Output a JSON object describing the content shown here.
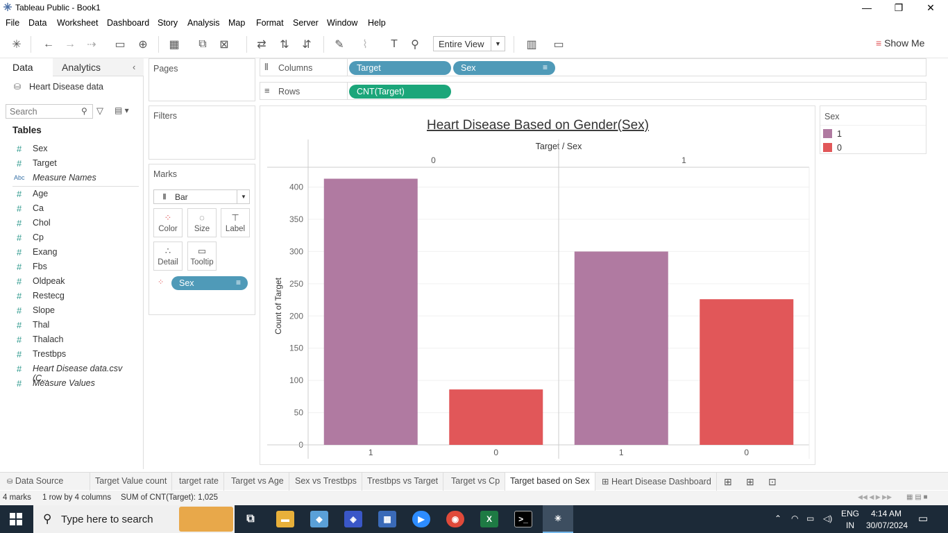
{
  "window": {
    "title": "Tableau Public - Book1",
    "minimize": "—",
    "maximize": "❐",
    "close": "✕"
  },
  "menu": [
    "File",
    "Data",
    "Worksheet",
    "Dashboard",
    "Story",
    "Analysis",
    "Map",
    "Format",
    "Server",
    "Window",
    "Help"
  ],
  "toolbar": {
    "fit_select": "Entire View",
    "show_me": "Show Me"
  },
  "data_pane": {
    "tab_data": "Data",
    "tab_analytics": "Analytics",
    "datasource": "Heart Disease data",
    "search_placeholder": "Search",
    "tables_heading": "Tables",
    "fields": [
      {
        "name": "Sex",
        "type": "number",
        "italic": false
      },
      {
        "name": "Target",
        "type": "number",
        "italic": false
      },
      {
        "name": "Measure Names",
        "type": "abc",
        "italic": true
      },
      {
        "name": "Age",
        "type": "number",
        "italic": false
      },
      {
        "name": "Ca",
        "type": "number",
        "italic": false
      },
      {
        "name": "Chol",
        "type": "number",
        "italic": false
      },
      {
        "name": "Cp",
        "type": "number",
        "italic": false
      },
      {
        "name": "Exang",
        "type": "number",
        "italic": false
      },
      {
        "name": "Fbs",
        "type": "number",
        "italic": false
      },
      {
        "name": "Oldpeak",
        "type": "number",
        "italic": false
      },
      {
        "name": "Restecg",
        "type": "number",
        "italic": false
      },
      {
        "name": "Slope",
        "type": "number",
        "italic": false
      },
      {
        "name": "Thal",
        "type": "number",
        "italic": false
      },
      {
        "name": "Thalach",
        "type": "number",
        "italic": false
      },
      {
        "name": "Trestbps",
        "type": "number",
        "italic": false
      },
      {
        "name": "Heart Disease data.csv (C...",
        "type": "number",
        "italic": true
      },
      {
        "name": "Measure Values",
        "type": "number",
        "italic": true
      }
    ]
  },
  "cards": {
    "pages": "Pages",
    "filters": "Filters",
    "marks": "Marks",
    "mark_type": "Bar",
    "mark_buttons": [
      "Color",
      "Size",
      "Label",
      "Detail",
      "Tooltip"
    ],
    "color_pill": "Sex"
  },
  "shelves": {
    "columns_label": "Columns",
    "rows_label": "Rows",
    "columns_pills": [
      "Target",
      "Sex"
    ],
    "rows_pills": [
      "CNT(Target)"
    ]
  },
  "legend": {
    "title": "Sex",
    "items": [
      {
        "label": "1",
        "color": "#b07aa1"
      },
      {
        "label": "0",
        "color": "#e15759"
      }
    ]
  },
  "chart_data": {
    "type": "bar",
    "title": "Heart Disease Based on Gender(Sex)",
    "header_title": "Target / Sex",
    "ylabel": "Count of Target",
    "yticks": [
      0,
      50,
      100,
      150,
      200,
      250,
      300,
      350,
      400
    ],
    "ylim": [
      0,
      420
    ],
    "grid": true,
    "panes": [
      {
        "target": "0",
        "bars": [
          {
            "sex": "1",
            "value": 413,
            "color": "#b07aa1"
          },
          {
            "sex": "0",
            "value": 86,
            "color": "#e15759"
          }
        ]
      },
      {
        "target": "1",
        "bars": [
          {
            "sex": "1",
            "value": 300,
            "color": "#b07aa1"
          },
          {
            "sex": "0",
            "value": 226,
            "color": "#e15759"
          }
        ]
      }
    ]
  },
  "sheet_tabs": [
    "Data Source",
    "Target Value count",
    "target rate",
    "Target vs Age",
    "Sex vs Trestbps",
    "Trestbps vs Target",
    "Target vs Cp",
    "Target based on Sex",
    "Heart Disease Dashboard"
  ],
  "active_tab": "Target based on Sex",
  "status": {
    "marks": "4 marks",
    "rows": "1 row by 4 columns",
    "sum": "SUM of CNT(Target): 1,025"
  },
  "taskbar": {
    "search_placeholder": "Type here to search",
    "lang1": "ENG",
    "lang2": "IN",
    "time": "4:14 AM",
    "date": "30/07/2024"
  }
}
